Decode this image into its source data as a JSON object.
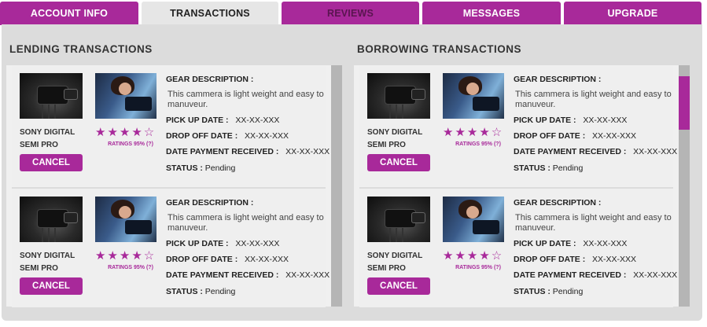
{
  "tabs": [
    {
      "label": "ACCOUNT INFO"
    },
    {
      "label": "TRANSACTIONS"
    },
    {
      "label": "REVIEWS"
    },
    {
      "label": "MESSAGES"
    },
    {
      "label": "UPGRADE"
    }
  ],
  "colors": {
    "accent": "#a8299a",
    "panel": "#dcdcdc",
    "card": "#efefef",
    "scrollbar": "#b5b5b5"
  },
  "lending": {
    "title": "LENDING TRANSACTIONS",
    "cards": [
      {
        "gear_name_line1": "SONY DIGITAL",
        "gear_name_line2": "SEMI PRO",
        "rating_stars": 4,
        "stars_filled": "★★★★",
        "stars_empty": "☆",
        "ratings_text": "RATINGS 95% (?)",
        "cancel_label": "CANCEL",
        "gear_description_label": "GEAR DESCRIPTION :",
        "gear_description": "This cammera is light weight and easy to manuveur.",
        "pickup_label": "PICK UP DATE :",
        "pickup_value": "XX-XX-XXX",
        "dropoff_label": "DROP OFF DATE :",
        "dropoff_value": "XX-XX-XXX",
        "payment_label": "DATE PAYMENT RECEIVED :",
        "payment_value": "XX-XX-XXX",
        "status_label": "STATUS :",
        "status_value": "Pending"
      },
      {
        "gear_name_line1": "SONY DIGITAL",
        "gear_name_line2": "SEMI PRO",
        "rating_stars": 4,
        "stars_filled": "★★★★",
        "stars_empty": "☆",
        "ratings_text": "RATINGS 95% (?)",
        "cancel_label": "CANCEL",
        "gear_description_label": "GEAR DESCRIPTION :",
        "gear_description": "This cammera is light weight and easy to manuveur.",
        "pickup_label": "PICK UP DATE :",
        "pickup_value": "XX-XX-XXX",
        "dropoff_label": "DROP OFF DATE :",
        "dropoff_value": "XX-XX-XXX",
        "payment_label": "DATE PAYMENT RECEIVED :",
        "payment_value": "XX-XX-XXX",
        "status_label": "STATUS :",
        "status_value": "Pending"
      }
    ]
  },
  "borrowing": {
    "title": "BORROWING TRANSACTIONS",
    "cards": [
      {
        "gear_name_line1": "SONY DIGITAL",
        "gear_name_line2": "SEMI PRO",
        "rating_stars": 4,
        "stars_filled": "★★★★",
        "stars_empty": "☆",
        "ratings_text": "RATINGS 95% (?)",
        "cancel_label": "CANCEL",
        "gear_description_label": "GEAR DESCRIPTION :",
        "gear_description": "This cammera is light weight and easy to manuveur.",
        "pickup_label": "PICK UP DATE :",
        "pickup_value": "XX-XX-XXX",
        "dropoff_label": "DROP OFF DATE :",
        "dropoff_value": "XX-XX-XXX",
        "payment_label": "DATE PAYMENT RECEIVED :",
        "payment_value": "XX-XX-XXX",
        "status_label": "STATUS :",
        "status_value": "Pending"
      },
      {
        "gear_name_line1": "SONY DIGITAL",
        "gear_name_line2": "SEMI PRO",
        "rating_stars": 4,
        "stars_filled": "★★★★",
        "stars_empty": "☆",
        "ratings_text": "RATINGS 95% (?)",
        "cancel_label": "CANCEL",
        "gear_description_label": "GEAR DESCRIPTION :",
        "gear_description": "This cammera is light weight and easy to manuveur.",
        "pickup_label": "PICK UP DATE :",
        "pickup_value": "XX-XX-XXX",
        "dropoff_label": "DROP OFF DATE :",
        "dropoff_value": "XX-XX-XXX",
        "payment_label": "DATE PAYMENT RECEIVED :",
        "payment_value": "XX-XX-XXX",
        "status_label": "STATUS :",
        "status_value": "Pending"
      }
    ]
  }
}
